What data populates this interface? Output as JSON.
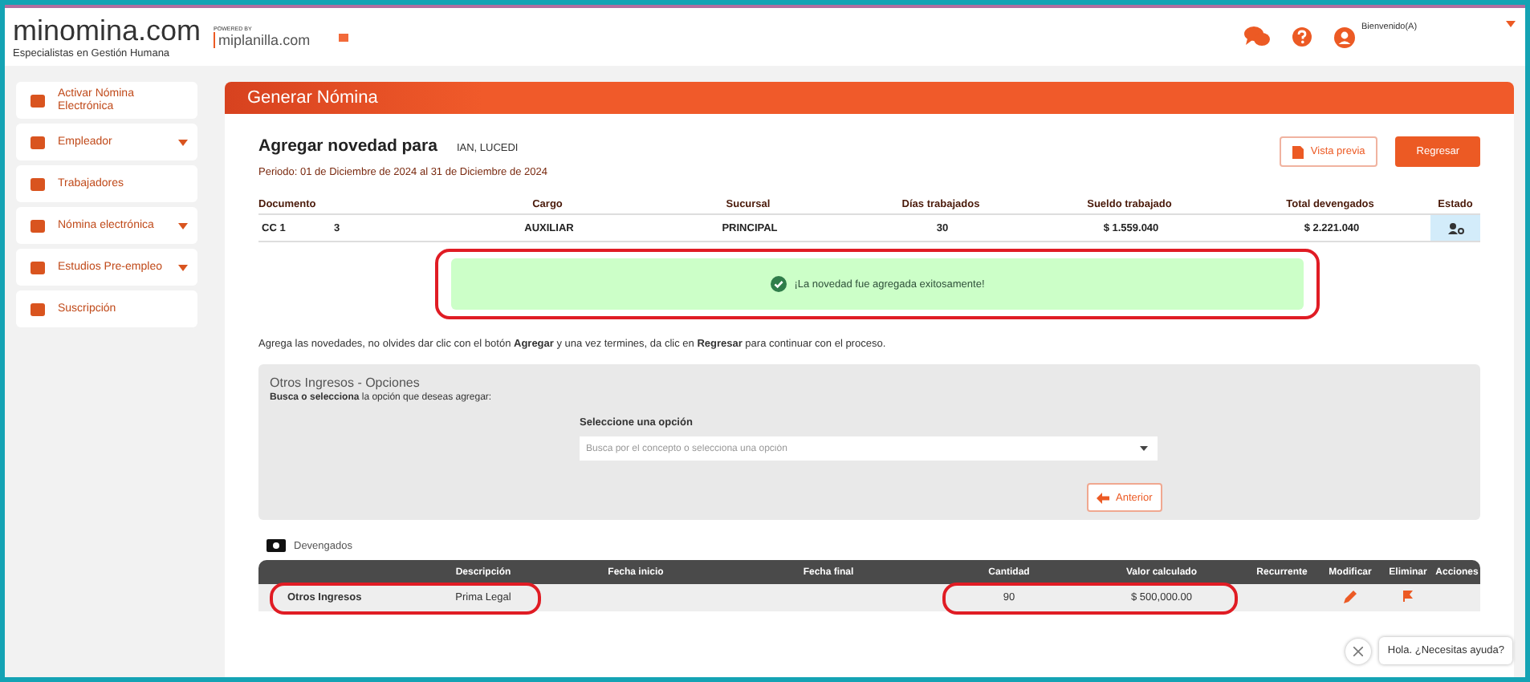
{
  "header": {
    "logo": "minomina.com",
    "tagline": "Especialistas en Gestión Humana",
    "powered_by": "POWERED BY",
    "partner": "miplanilla.com",
    "greeting": "Bienvenido(A)"
  },
  "sidebar": {
    "items": [
      {
        "label": "Activar Nómina Electrónica",
        "expandable": false
      },
      {
        "label": "Empleador",
        "expandable": true
      },
      {
        "label": "Trabajadores",
        "expandable": false
      },
      {
        "label": "Nómina electrónica",
        "expandable": true
      },
      {
        "label": "Estudios Pre-empleo",
        "expandable": true
      },
      {
        "label": "Suscripción",
        "expandable": false
      }
    ]
  },
  "page_title": "Generar Nómina",
  "heading": "Agregar novedad para",
  "employee": "IAN, LUCEDI",
  "period": "Periodo: 01 de Diciembre de 2024 al 31 de Diciembre de 2024",
  "buttons": {
    "preview": "Vista previa",
    "back": "Regresar"
  },
  "summary_table": {
    "columns": [
      "Documento",
      "Cargo",
      "Sucursal",
      "Días trabajados",
      "Sueldo trabajado",
      "Total devengados",
      "Estado"
    ],
    "row": {
      "doc_type": "CC 1",
      "doc_number": "3",
      "cargo": "AUXILIAR",
      "sucursal": "PRINCIPAL",
      "dias": "30",
      "sueldo": "$ 1.559.040",
      "total": "$ 2.221.040"
    }
  },
  "alert": {
    "message": "¡La novedad fue agregada exitosamente!",
    "highlighted": true
  },
  "instructions": "Agrega las novedades, no olvides dar clic con el botón **Agregar** y una vez termines, da clic en **Regresar** para continuar con el proceso.",
  "options": {
    "title": "Otros Ingresos - Opciones",
    "hint": "**Busca o selecciona** la opción que deseas agregar:",
    "select_label": "Seleccione una opción",
    "placeholder": "Busca por el concepto o selecciona una opción",
    "prev_button": "Anterior"
  },
  "devengados": {
    "title": "Devengados",
    "columns": [
      "Descripción",
      "Fecha inicio",
      "Fecha final",
      "Cantidad",
      "Valor calculado",
      "Recurrente",
      "Modificar",
      "Eliminar",
      "Acciones"
    ],
    "rows": [
      {
        "concept": "Otros Ingresos",
        "description": "Prima Legal",
        "quantity": "90",
        "value": "$ 500,000.00",
        "highlighted": true
      }
    ]
  },
  "chat": {
    "message": "Hola. ¿Necesitas ayuda?"
  }
}
